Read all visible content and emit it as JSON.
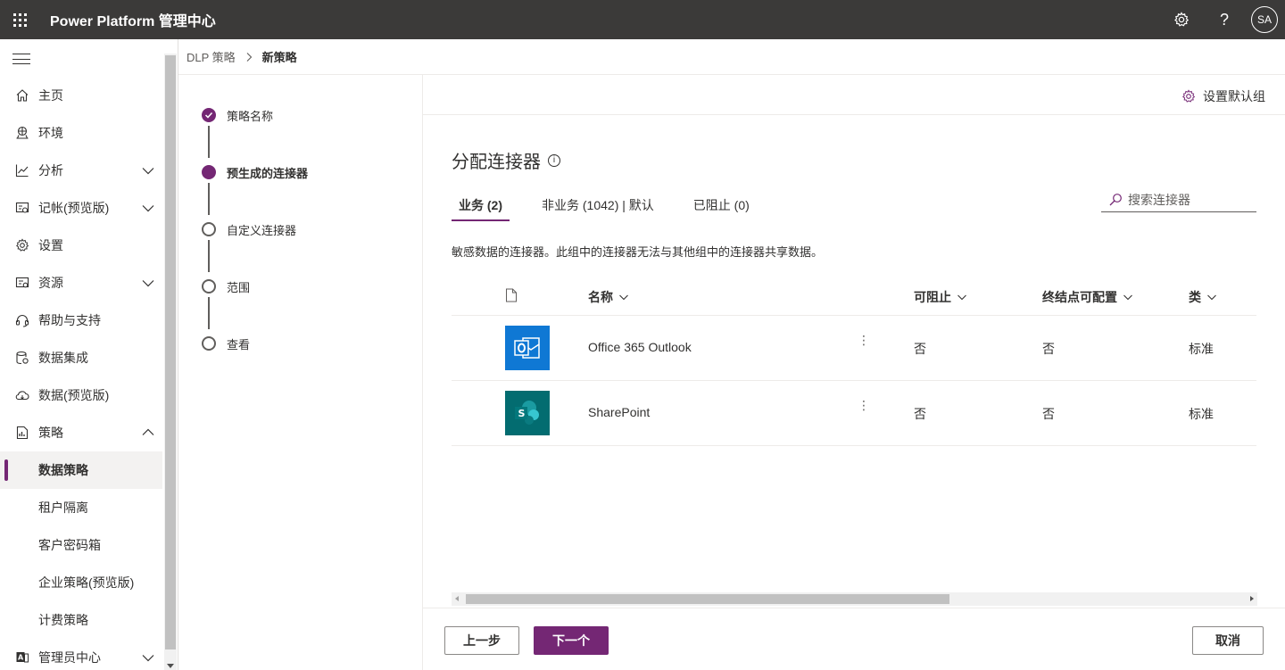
{
  "header": {
    "app_title": "Power Platform 管理中心",
    "avatar_initials": "SA"
  },
  "nav": {
    "items": [
      {
        "label": "主页"
      },
      {
        "label": "环境"
      },
      {
        "label": "分析"
      },
      {
        "label": "记帐(预览版)"
      },
      {
        "label": "设置"
      },
      {
        "label": "资源"
      },
      {
        "label": "帮助与支持"
      },
      {
        "label": "数据集成"
      },
      {
        "label": "数据(预览版)"
      },
      {
        "label": "策略"
      },
      {
        "label": "数据策略"
      },
      {
        "label": "租户隔离"
      },
      {
        "label": "客户密码箱"
      },
      {
        "label": "企业策略(预览版)"
      },
      {
        "label": "计费策略"
      },
      {
        "label": "管理员中心"
      }
    ],
    "selected": "数据策略"
  },
  "breadcrumb": {
    "parent": "DLP 策略",
    "current": "新策略"
  },
  "steps": [
    {
      "label": "策略名称",
      "state": "done"
    },
    {
      "label": "预生成的连接器",
      "state": "current"
    },
    {
      "label": "自定义连接器",
      "state": "todo"
    },
    {
      "label": "范围",
      "state": "todo"
    },
    {
      "label": "查看",
      "state": "todo"
    }
  ],
  "main": {
    "set_default_label": "设置默认组",
    "title": "分配连接器",
    "tabs": [
      {
        "label": "业务 (2)",
        "active": true
      },
      {
        "label": "非业务 (1042) | 默认",
        "active": false
      },
      {
        "label": "已阻止 (0)",
        "active": false
      }
    ],
    "search_placeholder": "搜索连接器",
    "description": "敏感数据的连接器。此组中的连接器无法与其他组中的连接器共享数据。",
    "table": {
      "columns": [
        "名称",
        "可阻止",
        "终结点可配置",
        "类"
      ],
      "rows": [
        {
          "name": "Office 365 Outlook",
          "blockable": "否",
          "endpoint": "否",
          "class": "标准",
          "icon": "outlook-icon"
        },
        {
          "name": "SharePoint",
          "blockable": "否",
          "endpoint": "否",
          "class": "标准",
          "icon": "sharepoint-icon"
        }
      ]
    }
  },
  "footer": {
    "back_label": "上一步",
    "next_label": "下一个",
    "cancel_label": "取消"
  },
  "colors": {
    "accent": "#742774",
    "topbar": "#3b3a39",
    "outlook": "#0f78d4",
    "sharepoint": "#036c70"
  }
}
